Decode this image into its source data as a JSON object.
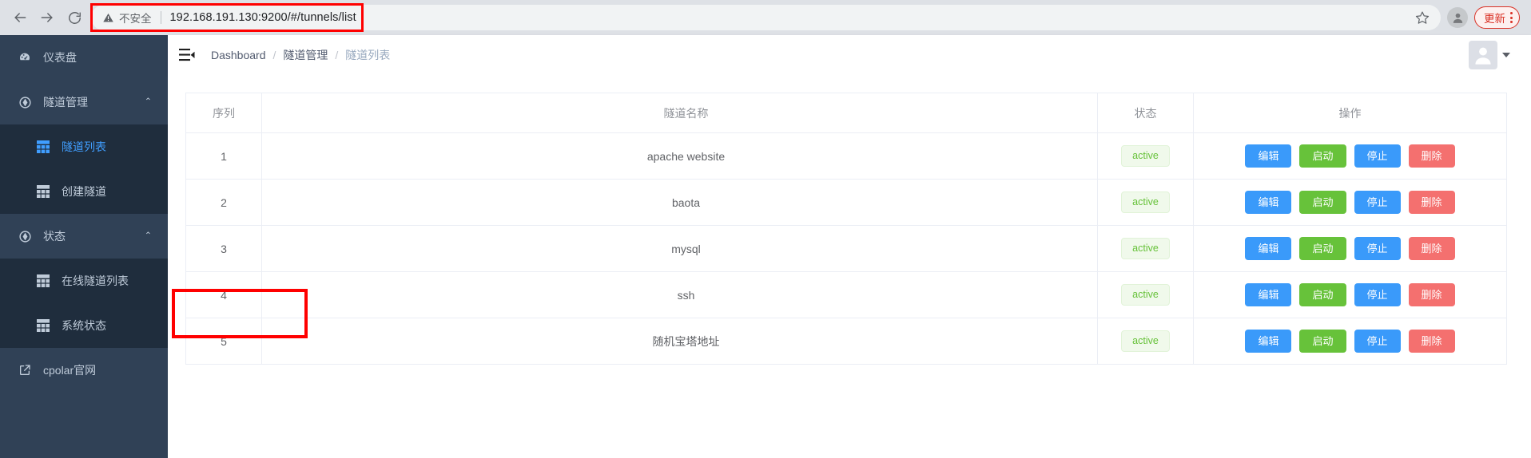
{
  "browser": {
    "back_icon": "back-arrow-icon",
    "forward_icon": "forward-arrow-icon",
    "reload_icon": "reload-icon",
    "security_label": "不安全",
    "warning_icon": "warning-triangle-icon",
    "url": "192.168.191.130:9200/#/tunnels/list",
    "bookmark_icon": "star-icon",
    "profile_icon": "profile-avatar-icon",
    "update_label": "更新",
    "menu_icon": "three-dot-menu-icon"
  },
  "sidebar": {
    "items": [
      {
        "label": "仪表盘",
        "icon": "dashboard-gauge-icon",
        "type": "item"
      },
      {
        "label": "隧道管理",
        "icon": "compass-icon",
        "type": "group",
        "caret": "⌃"
      },
      {
        "label": "隧道列表",
        "icon": "table-grid-icon",
        "type": "sub",
        "active": true
      },
      {
        "label": "创建隧道",
        "icon": "table-grid-icon",
        "type": "sub",
        "active": false
      },
      {
        "label": "状态",
        "icon": "compass-icon",
        "type": "group",
        "caret": "⌃"
      },
      {
        "label": "在线隧道列表",
        "icon": "table-grid-icon",
        "type": "sub",
        "active": false
      },
      {
        "label": "系统状态",
        "icon": "table-grid-icon",
        "type": "sub",
        "active": false
      },
      {
        "label": "cpolar官网",
        "icon": "external-link-icon",
        "type": "item"
      }
    ]
  },
  "navbar": {
    "collapse_icon": "hamburger-collapse-icon",
    "breadcrumb": [
      "Dashboard",
      "隧道管理",
      "隧道列表"
    ],
    "separator": "/",
    "avatar_icon": "user-avatar-icon",
    "caret_icon": "caret-down-icon"
  },
  "table": {
    "headers": {
      "seq": "序列",
      "name": "隧道名称",
      "status": "状态",
      "ops": "操作"
    },
    "buttons": {
      "edit": "编辑",
      "start": "启动",
      "stop": "停止",
      "delete": "删除"
    },
    "rows": [
      {
        "seq": "1",
        "name": "apache website",
        "status": "active"
      },
      {
        "seq": "2",
        "name": "baota",
        "status": "active"
      },
      {
        "seq": "3",
        "name": "mysql",
        "status": "active"
      },
      {
        "seq": "4",
        "name": "ssh",
        "status": "active"
      },
      {
        "seq": "5",
        "name": "随机宝塔地址",
        "status": "active"
      }
    ]
  },
  "annotations": [
    {
      "name": "url-highlight",
      "color": "#ff0000"
    },
    {
      "name": "ssh-row-highlight",
      "color": "#ff0000"
    }
  ],
  "colors": {
    "sidebar_bg": "#304156",
    "submenu_bg": "#1f2d3d",
    "active_blue": "#409eff",
    "button_blue": "#3a9afa",
    "button_green": "#67c23a",
    "button_red": "#f4706f",
    "badge_green_text": "#67c23a",
    "badge_green_bg": "#f0f9eb",
    "annotation_red": "#ff0000"
  }
}
